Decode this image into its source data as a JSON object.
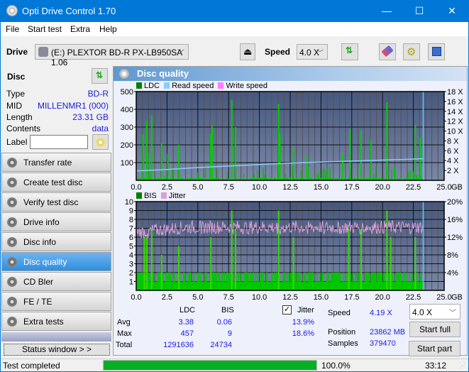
{
  "window": {
    "title": "Opti Drive Control 1.70",
    "minimize": "—",
    "maximize": "☐",
    "close": "✕"
  },
  "menu": [
    "File",
    "Start test",
    "Extra",
    "Help"
  ],
  "toolbar": {
    "drive_label": "Drive",
    "drive_value": "(E:)  PLEXTOR BD-R  PX-LB950SA 1.06",
    "speed_label": "Speed",
    "speed_value": "4.0 X"
  },
  "disc": {
    "title": "Disc",
    "type_k": "Type",
    "type_v": "BD-R",
    "mid_k": "MID",
    "mid_v": "MILLENMR1 (000)",
    "length_k": "Length",
    "length_v": "23.31 GB",
    "contents_k": "Contents",
    "contents_v": "data",
    "label_k": "Label",
    "label_v": ""
  },
  "nav": [
    {
      "label": "Transfer rate"
    },
    {
      "label": "Create test disc"
    },
    {
      "label": "Verify test disc"
    },
    {
      "label": "Drive info"
    },
    {
      "label": "Disc info"
    },
    {
      "label": "Disc quality",
      "active": true
    },
    {
      "label": "CD Bler"
    },
    {
      "label": "FE / TE"
    },
    {
      "label": "Extra tests"
    }
  ],
  "status_window_btn": "Status window > >",
  "panel": {
    "title": "Disc quality"
  },
  "chart_data": [
    {
      "type": "bar",
      "title": "LDC / Read speed",
      "legend": [
        "LDC",
        "Read speed",
        "Write speed"
      ],
      "legend_colors": [
        "#008000",
        "#87cefa",
        "#ff80ff"
      ],
      "xlabel": "GB",
      "x_ticks": [
        "0.0",
        "2.5",
        "5.0",
        "7.5",
        "10.0",
        "12.5",
        "15.0",
        "17.5",
        "20.0",
        "22.5",
        "25.0"
      ],
      "xlim": [
        0,
        25
      ],
      "y_ticks": [
        "500",
        "400",
        "300",
        "200",
        "100"
      ],
      "ylim": [
        0,
        500
      ],
      "y2_ticks": [
        "18 X",
        "16 X",
        "14 X",
        "12 X",
        "10 X",
        "8 X",
        "6 X",
        "4 X",
        "2 X"
      ],
      "y2lim": [
        0,
        18
      ],
      "ldc_peaks": [
        [
          0.5,
          260
        ],
        [
          0.8,
          335
        ],
        [
          1.0,
          150
        ],
        [
          1.2,
          365
        ],
        [
          2.0,
          210
        ],
        [
          2.5,
          150
        ],
        [
          3.4,
          200
        ],
        [
          6.0,
          265
        ],
        [
          6.1,
          310
        ],
        [
          7.7,
          455
        ],
        [
          8.0,
          300
        ],
        [
          11.5,
          430
        ],
        [
          11.6,
          260
        ],
        [
          12.7,
          185
        ],
        [
          13.8,
          140
        ],
        [
          16.7,
          150
        ],
        [
          17.3,
          290
        ],
        [
          18.2,
          280
        ],
        [
          19.0,
          230
        ],
        [
          20.3,
          440
        ],
        [
          22.6,
          310
        ],
        [
          23.0,
          240
        ]
      ],
      "read_speed": [
        [
          0,
          1.9
        ],
        [
          2.5,
          2.2
        ],
        [
          5,
          2.6
        ],
        [
          7.5,
          2.9
        ],
        [
          10,
          3.2
        ],
        [
          12.5,
          3.5
        ],
        [
          15,
          3.7
        ],
        [
          17.5,
          3.9
        ],
        [
          20,
          4.1
        ],
        [
          22.5,
          4.3
        ],
        [
          23.3,
          4.4
        ]
      ],
      "ldc_avg": 3.38,
      "ldc_max": 457,
      "ldc_total": 1291636
    },
    {
      "type": "bar",
      "title": "BIS / Jitter",
      "legend": [
        "BIS",
        "Jitter"
      ],
      "legend_colors": [
        "#008000",
        "#d8a0d8"
      ],
      "xlabel": "GB",
      "x_ticks": [
        "0.0",
        "2.5",
        "5.0",
        "7.5",
        "10.0",
        "12.5",
        "15.0",
        "17.5",
        "20.0",
        "22.5",
        "25.0"
      ],
      "xlim": [
        0,
        25
      ],
      "y_ticks": [
        "10",
        "9",
        "8",
        "7",
        "6",
        "5",
        "4",
        "3",
        "2",
        "1"
      ],
      "ylim": [
        0,
        10
      ],
      "y2_ticks": [
        "20%",
        "16%",
        "12%",
        "8%",
        "4%"
      ],
      "y2lim": [
        0,
        20
      ],
      "bis_peaks": [
        [
          0.6,
          6
        ],
        [
          0.8,
          6
        ],
        [
          1.2,
          7
        ],
        [
          2.0,
          4
        ],
        [
          3.4,
          5
        ],
        [
          6.0,
          6
        ],
        [
          7.7,
          9
        ],
        [
          8.0,
          7
        ],
        [
          11.5,
          9
        ],
        [
          12.7,
          6
        ],
        [
          17.2,
          7
        ],
        [
          18.2,
          7
        ],
        [
          20.3,
          9
        ],
        [
          20.6,
          6
        ],
        [
          22.6,
          6
        ]
      ],
      "jitter_avg_pct": 13.9,
      "jitter_max_pct": 18.6,
      "bis_avg": 0.06,
      "bis_max": 9,
      "bis_total": 24734
    }
  ],
  "stats": {
    "col_ldc": "LDC",
    "col_bis": "BIS",
    "jitter_label": "Jitter",
    "jitter_checked": true,
    "avg_label": "Avg",
    "max_label": "Max",
    "total_label": "Total",
    "ldc_avg": "3.38",
    "bis_avg": "0.06",
    "jit_avg": "13.9%",
    "ldc_max": "457",
    "bis_max": "9",
    "jit_max": "18.6%",
    "ldc_total": "1291636",
    "bis_total": "24734",
    "speed_label": "Speed",
    "speed_val": "4.19 X",
    "position_label": "Position",
    "position_val": "23862 MB",
    "samples_label": "Samples",
    "samples_val": "379470",
    "speed_select": "4.0 X",
    "start_full": "Start full",
    "start_part": "Start part"
  },
  "status": {
    "text": "Test completed",
    "progress_pct": 100,
    "progress_text": "100.0%",
    "time": "33:12"
  }
}
